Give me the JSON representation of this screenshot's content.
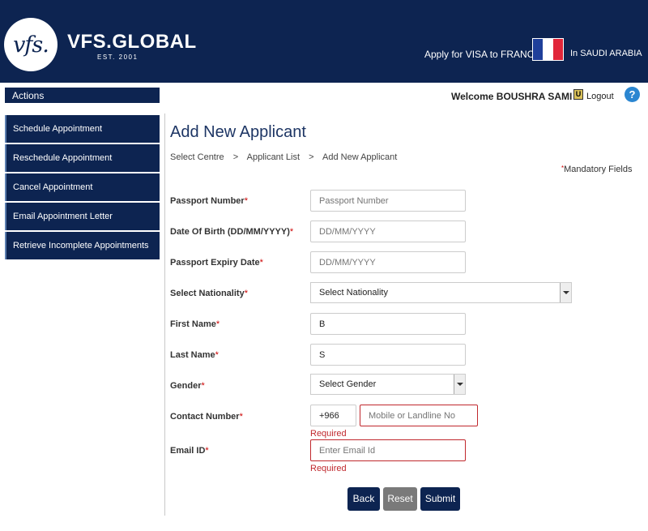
{
  "header": {
    "logo_text": "vfs.",
    "brand": "VFS.GLOBAL",
    "est": "EST. 2001",
    "apply_text": "Apply for VISA to FRANCE",
    "country_text": "In SAUDI ARABIA",
    "flag_colors": [
      "#1f3f9a",
      "#ffffff",
      "#e1263a"
    ]
  },
  "sidebar": {
    "title": "Actions",
    "items": [
      {
        "label": "Schedule Appointment"
      },
      {
        "label": "Reschedule Appointment"
      },
      {
        "label": "Cancel Appointment"
      },
      {
        "label": "Email Appointment Letter"
      },
      {
        "label": "Retrieve Incomplete Appointments"
      }
    ]
  },
  "topbar": {
    "welcome": "Welcome BOUSHRA SAMI !",
    "logout": "Logout",
    "help": "?"
  },
  "page": {
    "title": "Add New Applicant",
    "breadcrumb": [
      "Select Centre",
      ">",
      "Applicant List",
      ">",
      "Add New Applicant"
    ],
    "mandatory_mark": "*",
    "mandatory_text": "Mandatory Fields"
  },
  "form": {
    "passport_number": {
      "label": "Passport Number",
      "placeholder": "Passport Number",
      "value": ""
    },
    "dob": {
      "label": "Date Of Birth (DD/MM/YYYY)",
      "placeholder": "DD/MM/YYYY",
      "value": ""
    },
    "passport_expiry": {
      "label": "Passport Expiry Date",
      "placeholder": "DD/MM/YYYY",
      "value": ""
    },
    "nationality": {
      "label": "Select Nationality",
      "selected": "Select Nationality"
    },
    "first_name": {
      "label": "First Name",
      "value": "B"
    },
    "last_name": {
      "label": "Last Name",
      "value": "S"
    },
    "gender": {
      "label": "Gender",
      "selected": "Select Gender"
    },
    "contact": {
      "label": "Contact Number",
      "code": "+966",
      "placeholder": "Mobile or Landline No",
      "error": "Required"
    },
    "email": {
      "label": "Email ID",
      "placeholder": "Enter Email Id",
      "error": "Required"
    },
    "required_mark": "*"
  },
  "buttons": {
    "back": "Back",
    "reset": "Reset",
    "submit": "Submit"
  }
}
